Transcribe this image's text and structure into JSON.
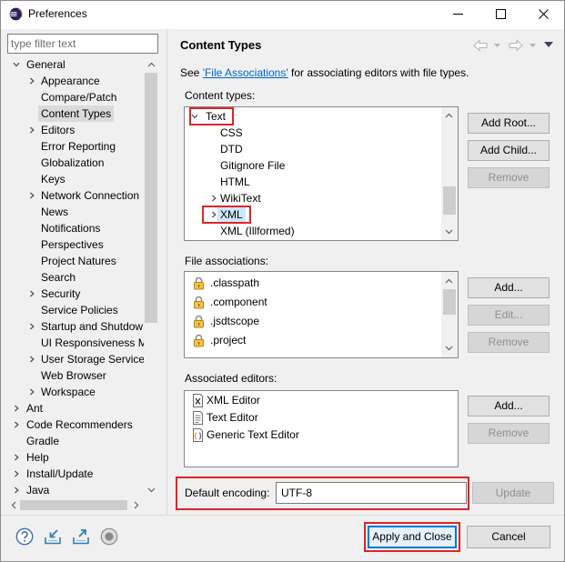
{
  "window": {
    "title": "Preferences"
  },
  "filter": {
    "placeholder": "type filter text",
    "value": ""
  },
  "nav_tree": {
    "items": [
      {
        "label": "General",
        "level": 0,
        "toggle": "expanded"
      },
      {
        "label": "Appearance",
        "level": 1,
        "toggle": "collapsed"
      },
      {
        "label": "Compare/Patch",
        "level": 1
      },
      {
        "label": "Content Types",
        "level": 1,
        "selected": true
      },
      {
        "label": "Editors",
        "level": 1,
        "toggle": "collapsed"
      },
      {
        "label": "Error Reporting",
        "level": 1
      },
      {
        "label": "Globalization",
        "level": 1
      },
      {
        "label": "Keys",
        "level": 1
      },
      {
        "label": "Network Connection",
        "level": 1,
        "toggle": "collapsed"
      },
      {
        "label": "News",
        "level": 1
      },
      {
        "label": "Notifications",
        "level": 1
      },
      {
        "label": "Perspectives",
        "level": 1
      },
      {
        "label": "Project Natures",
        "level": 1
      },
      {
        "label": "Search",
        "level": 1
      },
      {
        "label": "Security",
        "level": 1,
        "toggle": "collapsed"
      },
      {
        "label": "Service Policies",
        "level": 1
      },
      {
        "label": "Startup and Shutdow",
        "level": 1,
        "toggle": "collapsed"
      },
      {
        "label": "UI Responsiveness M",
        "level": 1
      },
      {
        "label": "User Storage Service",
        "level": 1,
        "toggle": "collapsed"
      },
      {
        "label": "Web Browser",
        "level": 1
      },
      {
        "label": "Workspace",
        "level": 1,
        "toggle": "collapsed"
      },
      {
        "label": "Ant",
        "level": 0,
        "toggle": "collapsed"
      },
      {
        "label": "Code Recommenders",
        "level": 0,
        "toggle": "collapsed"
      },
      {
        "label": "Gradle",
        "level": 0
      },
      {
        "label": "Help",
        "level": 0,
        "toggle": "collapsed"
      },
      {
        "label": "Install/Update",
        "level": 0,
        "toggle": "collapsed"
      },
      {
        "label": "Java",
        "level": 0,
        "toggle": "collapsed"
      }
    ]
  },
  "page": {
    "title": "Content Types",
    "description_prefix": "See ",
    "description_link": "'File Associations'",
    "description_suffix": " for associating editors with file types.",
    "nav_icons": [
      "back-arrow-icon",
      "back-dropdown-icon",
      "forward-arrow-icon",
      "forward-dropdown-icon",
      "view-menu-icon"
    ]
  },
  "content_types": {
    "label": "Content types:",
    "items": [
      {
        "label": "Text",
        "level": 0,
        "toggle": "expanded",
        "highlighted": true
      },
      {
        "label": "CSS",
        "level": 1
      },
      {
        "label": "DTD",
        "level": 1
      },
      {
        "label": "Gitignore File",
        "level": 1
      },
      {
        "label": "HTML",
        "level": 1
      },
      {
        "label": "WikiText",
        "level": 1,
        "toggle": "collapsed"
      },
      {
        "label": "XML",
        "level": 1,
        "toggle": "collapsed",
        "selected": true,
        "highlighted": true
      },
      {
        "label": "XML (Illformed)",
        "level": 1
      }
    ],
    "buttons": {
      "add_root": {
        "label": "Add Root...",
        "enabled": true
      },
      "add_child": {
        "label": "Add Child...",
        "enabled": true
      },
      "remove": {
        "label": "Remove",
        "enabled": false
      }
    }
  },
  "file_associations": {
    "label": "File associations:",
    "items": [
      {
        "label": ".classpath",
        "icon": "lock-icon"
      },
      {
        "label": ".component",
        "icon": "lock-icon"
      },
      {
        "label": ".jsdtscope",
        "icon": "lock-icon"
      },
      {
        "label": ".project",
        "icon": "lock-icon"
      }
    ],
    "buttons": {
      "add": {
        "label": "Add...",
        "enabled": true
      },
      "edit": {
        "label": "Edit...",
        "enabled": false
      },
      "remove": {
        "label": "Remove",
        "enabled": false
      }
    }
  },
  "associated_editors": {
    "label": "Associated editors:",
    "items": [
      {
        "label": "XML Editor",
        "icon": "xml-editor-icon"
      },
      {
        "label": "Text Editor",
        "icon": "text-editor-icon"
      },
      {
        "label": "Generic Text Editor",
        "icon": "generic-editor-icon"
      }
    ],
    "buttons": {
      "add": {
        "label": "Add...",
        "enabled": true
      },
      "remove": {
        "label": "Remove",
        "enabled": false
      }
    }
  },
  "encoding": {
    "label": "Default encoding:",
    "value": "UTF-8",
    "update": {
      "label": "Update",
      "enabled": false
    }
  },
  "footer": {
    "icons": [
      "help-icon",
      "import-icon",
      "export-icon",
      "oomph-record-icon"
    ],
    "apply_close": "Apply and Close",
    "cancel": "Cancel"
  },
  "colors": {
    "highlight_red": "#e02424",
    "link": "#0066cc",
    "selection_gray": "#dadada",
    "selection_blue": "#cce8ff",
    "default_button_border": "#0078d7"
  }
}
